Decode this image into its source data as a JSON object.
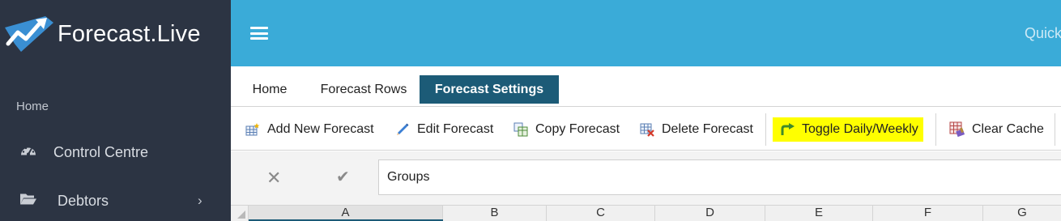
{
  "app": {
    "logo_text": "Forecast.Live"
  },
  "sidebar": {
    "section_label": "Home",
    "items": [
      {
        "label": "Control Centre",
        "icon": "dashboard-icon"
      },
      {
        "label": "Debtors",
        "icon": "folder-open-icon",
        "chevron": "›"
      }
    ]
  },
  "topbar": {
    "quick_text": "Quick"
  },
  "ribbon": {
    "tabs": [
      {
        "label": "Home",
        "active": false
      },
      {
        "label": "Forecast Rows",
        "active": false
      },
      {
        "label": "Forecast Settings",
        "active": true
      }
    ]
  },
  "toolbar": {
    "buttons": [
      {
        "label": "Add New Forecast",
        "icon": "add-table-icon"
      },
      {
        "label": "Edit Forecast",
        "icon": "pencil-icon"
      },
      {
        "label": "Copy Forecast",
        "icon": "copy-icon"
      },
      {
        "label": "Delete Forecast",
        "icon": "delete-table-icon"
      },
      {
        "label": "Toggle Daily/Weekly",
        "icon": "toggle-arrow-icon",
        "highlighted": true
      },
      {
        "label": "Clear Cache",
        "icon": "clear-cache-icon"
      }
    ]
  },
  "formula_bar": {
    "cancel_symbol": "✕",
    "accept_symbol": "✔",
    "value": "Groups"
  },
  "sheet": {
    "columns": [
      "A",
      "B",
      "C",
      "D",
      "E",
      "F",
      "G"
    ],
    "selected_column": "A"
  },
  "colors": {
    "sidebar_bg": "#2c3443",
    "topbar_bg": "#3aabd8",
    "active_tab_bg": "#1c5b77",
    "highlight": "#ffff00"
  }
}
